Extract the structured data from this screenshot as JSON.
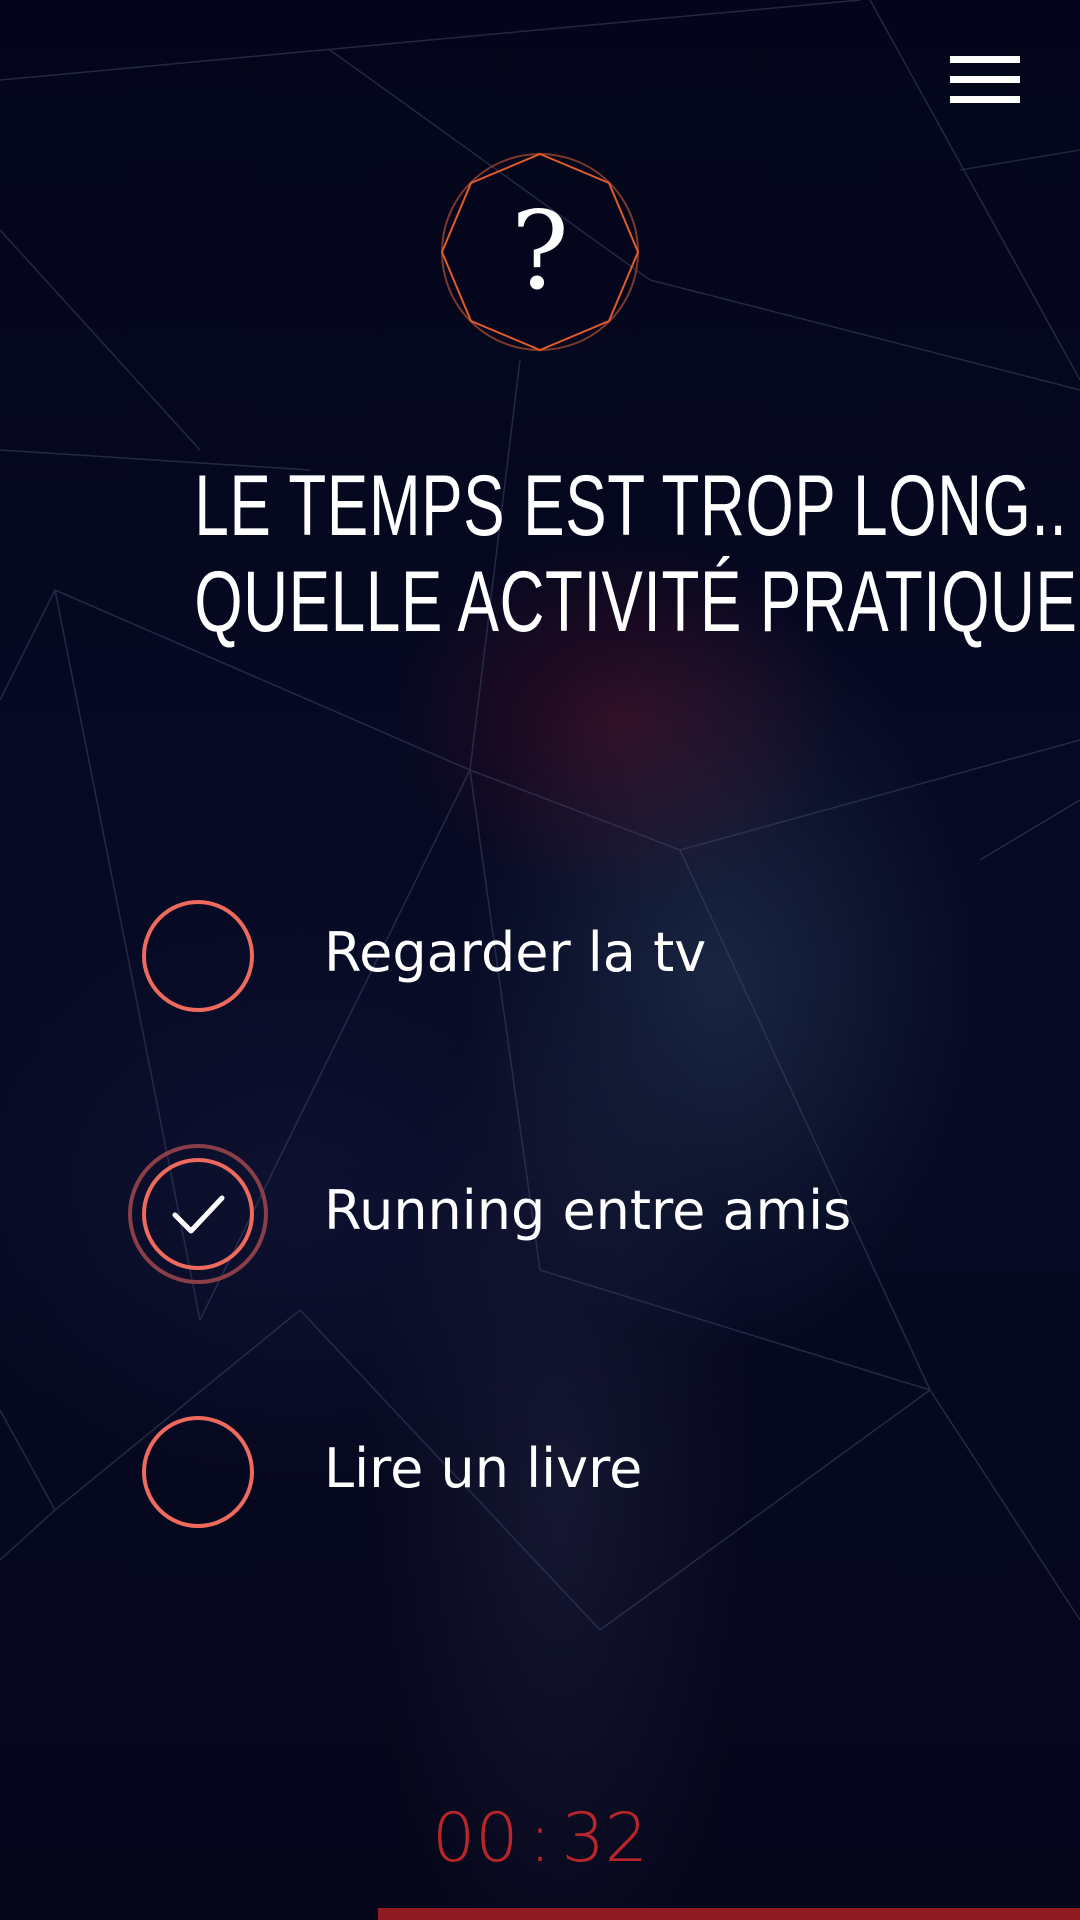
{
  "menu": {
    "icon": "hamburger-menu-icon"
  },
  "question": {
    "icon": "question-mark",
    "badge_glyph": "?",
    "title_line_1": "LE TEMPS EST TROP LONG..",
    "title_line_2": "QUELLE ACTIVITÉ PRATIQUER ?"
  },
  "answers": [
    {
      "label": "Regarder la tv",
      "selected": false
    },
    {
      "label": "Running entre amis",
      "selected": true
    },
    {
      "label": "Lire un livre",
      "selected": false
    }
  ],
  "timer": {
    "minutes": "00",
    "separator": ":",
    "seconds": "32"
  },
  "progress": {
    "remaining_fraction": 0.65
  },
  "colors": {
    "background": "#05061a",
    "accent": "#ef6a5e",
    "badge_outline": "#e05a2a",
    "timer": "#b8262a",
    "progress": "#8e1c22"
  }
}
